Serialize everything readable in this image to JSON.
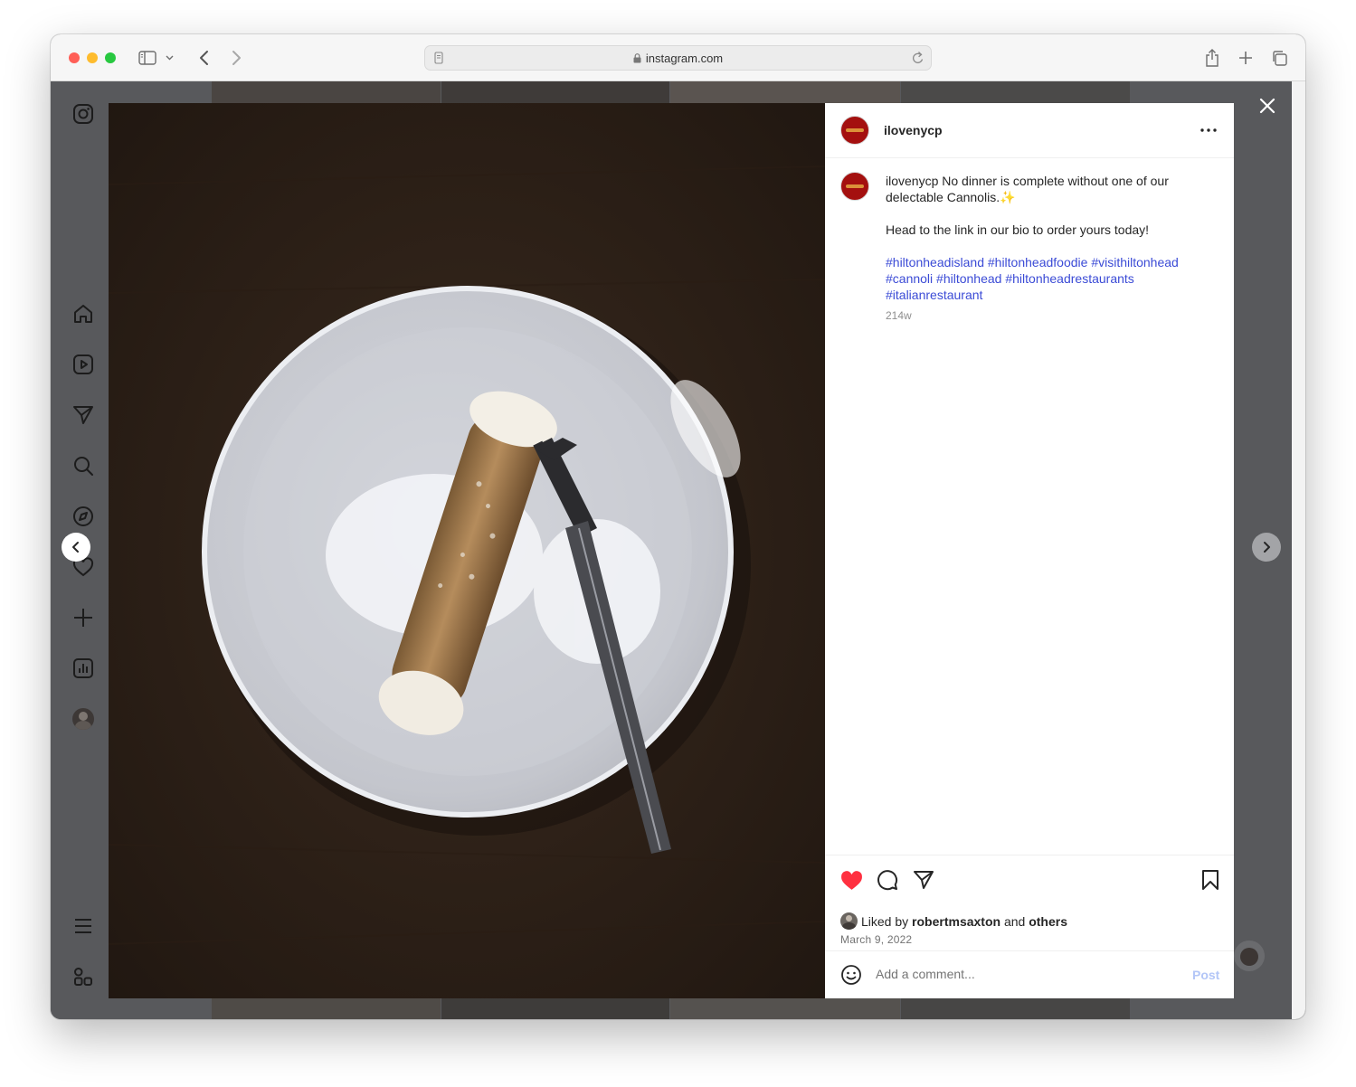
{
  "browser": {
    "url": "instagram.com",
    "traffic_lights": {
      "close": "#ff5f57",
      "minimize": "#febc2e",
      "zoom": "#28c840"
    },
    "icons": [
      "sidebar-toggle-icon",
      "chevron-down-icon",
      "back-icon",
      "forward-icon",
      "reader-icon",
      "lock-icon",
      "reload-icon",
      "share-icon",
      "new-tab-icon",
      "tab-overview-icon"
    ]
  },
  "sidebar": {
    "icons": [
      "instagram-logo-icon",
      "home-icon",
      "reels-icon",
      "direct-icon",
      "search-icon",
      "explore-icon",
      "notifications-icon",
      "create-icon",
      "dashboard-icon",
      "profile-avatar",
      "menu-icon",
      "threads-icon"
    ]
  },
  "post": {
    "username": "ilovenycp",
    "caption": {
      "username": "ilovenycp",
      "text": "No dinner is complete without one of our delectable Cannolis.",
      "emoji": "✨",
      "line2": "Head to the link in our bio to order yours today!",
      "hashtags": [
        "#hiltonheadisland",
        "#hiltonheadfoodie",
        "#visithiltonhead",
        "#cannoli",
        "#hiltonhead",
        "#hiltonheadrestaurants",
        "#italianrestaurant"
      ]
    },
    "time_ago": "214w",
    "liked_by_prefix": "Liked by",
    "liked_by_user": "robertmsaxton",
    "liked_by_and": "and",
    "liked_by_others": "others",
    "date": "March 9, 2022",
    "comment_placeholder": "Add a comment...",
    "post_label": "Post",
    "accent_like": "#ff3040",
    "link_color": "#3b4bd6"
  }
}
